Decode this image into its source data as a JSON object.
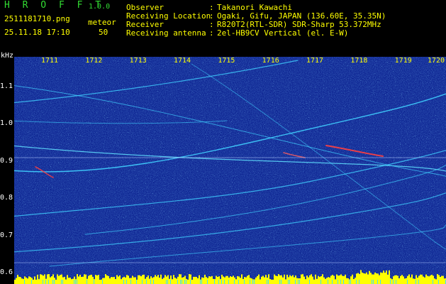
{
  "header": {
    "app_title": "H R O F F T",
    "app_version": "1.0.0",
    "file_name": "2511181710.png",
    "datetime": "25.11.18 17:10",
    "mode_label": "meteor",
    "count_value": "50"
  },
  "info": [
    {
      "label": "Observer",
      "value": "Takanori Kawachi"
    },
    {
      "label": "Receiving Location",
      "value": "Ogaki, Gifu, JAPAN (136.60E, 35.35N)"
    },
    {
      "label": "Receiver",
      "value": "R820T2(RTL-SDR) SDR-Sharp 53.372MHz"
    },
    {
      "label": "Receiving antenna",
      "value": "2el-HB9CV Vertical (el. E-W)"
    }
  ],
  "chart_data": {
    "type": "heatmap",
    "ylabel": "kHz",
    "x_ticks": [
      "1711",
      "1712",
      "1713",
      "1714",
      "1715",
      "1716",
      "1717",
      "1718",
      "1719",
      "1720"
    ],
    "y_ticks": [
      "1.1",
      "1.0",
      "0.9",
      "0.8",
      "0.7",
      "0.6"
    ],
    "ylim": [
      0.57,
      1.18
    ],
    "colors": {
      "background": "#081c8c",
      "trace": "#40d0ff",
      "hot": "#ff4040",
      "baseline": "#ffff00",
      "label": "#ffff00"
    }
  }
}
